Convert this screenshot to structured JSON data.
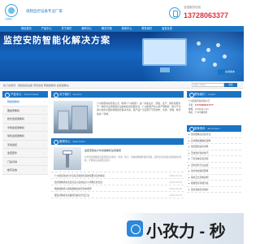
{
  "header": {
    "logo_text": "上海监控",
    "brand": "视频监控设备专业厂家",
    "hotline_label": "全国服务热线",
    "hotline_number": "13728063377"
  },
  "nav": {
    "items": [
      "网站首页",
      "产品中心",
      "关于我们",
      "案例中心",
      "解决方案",
      "新闻中心",
      "联系我们",
      "留言反馈"
    ]
  },
  "banner": {
    "headline": "监控安防智能化解决方案"
  },
  "searchbar": {
    "hotwords": "热门关键词：视频监控设备  安防监控  网络摄像机  监控摄像头",
    "search_placeholder": "请输入关键词",
    "search_button": "搜索"
  },
  "products": {
    "title": "产品中心",
    "subtitle": "Product Center",
    "items": [
      "网络摄像机",
      "硬盘录像机",
      "枪式监控摄像机",
      "半球监控摄像机",
      "球机监控摄像机",
      "无线监控",
      "监控配件",
      "门禁对讲",
      "楼宇系统"
    ]
  },
  "about": {
    "title": "关于我们",
    "subtitle": "About Us",
    "text": "广州耐辰科技有限公司（简称\"广州耐辰\"）是一家集设计、研发、生产、销售和服务于一体的专业视频监控设备制造商和服务商，广州耐辰开创以来产销两旺，致力于为客户提供全面的视频监控解决方案，其产品广泛应用于平安城市、交通、金融、教育等多个领域。"
  },
  "news": {
    "title": "新闻中心",
    "subtitle": "News Center",
    "featured_title": "监控安装在户外的摄像机注意事项",
    "featured_desc": "户外监控摄像机安装需要考虑防水、防雷、防尘、供电和网线传输等问题，选择合适的安装位置和防护等级，才能保证设备稳定运行。",
    "rows": [
      {
        "text": "广州耐辰科技分享安装无线监控系统需要注意的事项",
        "date": "2024-05-10"
      },
      {
        "text": "监控摄像机的安装高度以及角度怎么调整比较合适",
        "date": "2024-05-08"
      },
      {
        "text": "网络摄像机与模拟摄像机的区别在哪里",
        "date": "2024-05-06"
      },
      {
        "text": "硬盘录像机常见故障及解决方法汇总",
        "date": "2024-05-03"
      }
    ]
  },
  "contact": {
    "title": "联系我们",
    "subtitle": "Contact",
    "company": "广州耐辰科技有限公司",
    "phone_label": "手机：",
    "phone": "13728063377",
    "email": "邮箱：xxx@qq.com",
    "address": "地址：广州市番禺区"
  },
  "side_news": {
    "title": "推荐资讯",
    "subtitle": "Recommend",
    "items": [
      "监控摄像头安装方法",
      "高清网络摄像机选购",
      "监控硬盘如何选择",
      "无线监控使用技巧",
      "门禁系统安装流程",
      "安防监控行业发展",
      "监控布线规范要求",
      "球机云台控制说明",
      "视频监控存储方案",
      "监控系统日常维护"
    ]
  },
  "float_button": "在线留言",
  "watermark": {
    "text": "小孜力 - 秒"
  }
}
